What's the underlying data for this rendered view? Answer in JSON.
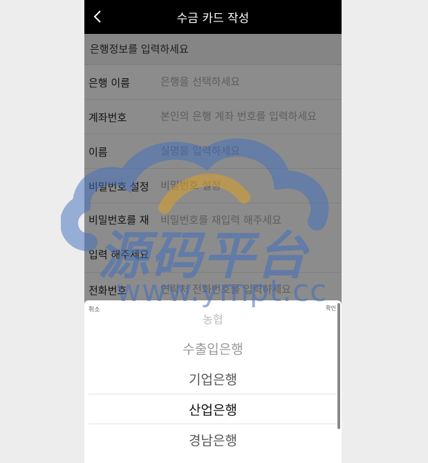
{
  "header": {
    "title": "수금 카드 작성"
  },
  "form": {
    "section_title": "은행정보를 입력하세요",
    "rows": [
      {
        "label": "은행 이름",
        "placeholder": "은행을 선택하세요"
      },
      {
        "label": "계좌번호",
        "placeholder": "본인의 은행 계좌 번호를 입력하세요"
      },
      {
        "label": "이름",
        "placeholder": "실명을 입력하세요"
      },
      {
        "label": "비밀번호 설정",
        "placeholder": "비밀번호 설정"
      },
      {
        "label": "비밀번호를 재 입력 해주세요",
        "placeholder": "비밀번호를 재입력 해주세요"
      },
      {
        "label": "전화번호",
        "placeholder": "연락처 전화번호를 입력하세요"
      }
    ]
  },
  "picker": {
    "cancel_label": "취소",
    "confirm_label": "확인",
    "options": [
      "농협",
      "수출입은행",
      "기업은행",
      "산업은행",
      "경남은행"
    ],
    "selected": "산업은행"
  },
  "watermark": {
    "text": "源码平台",
    "url": "www.ympt.cc"
  }
}
